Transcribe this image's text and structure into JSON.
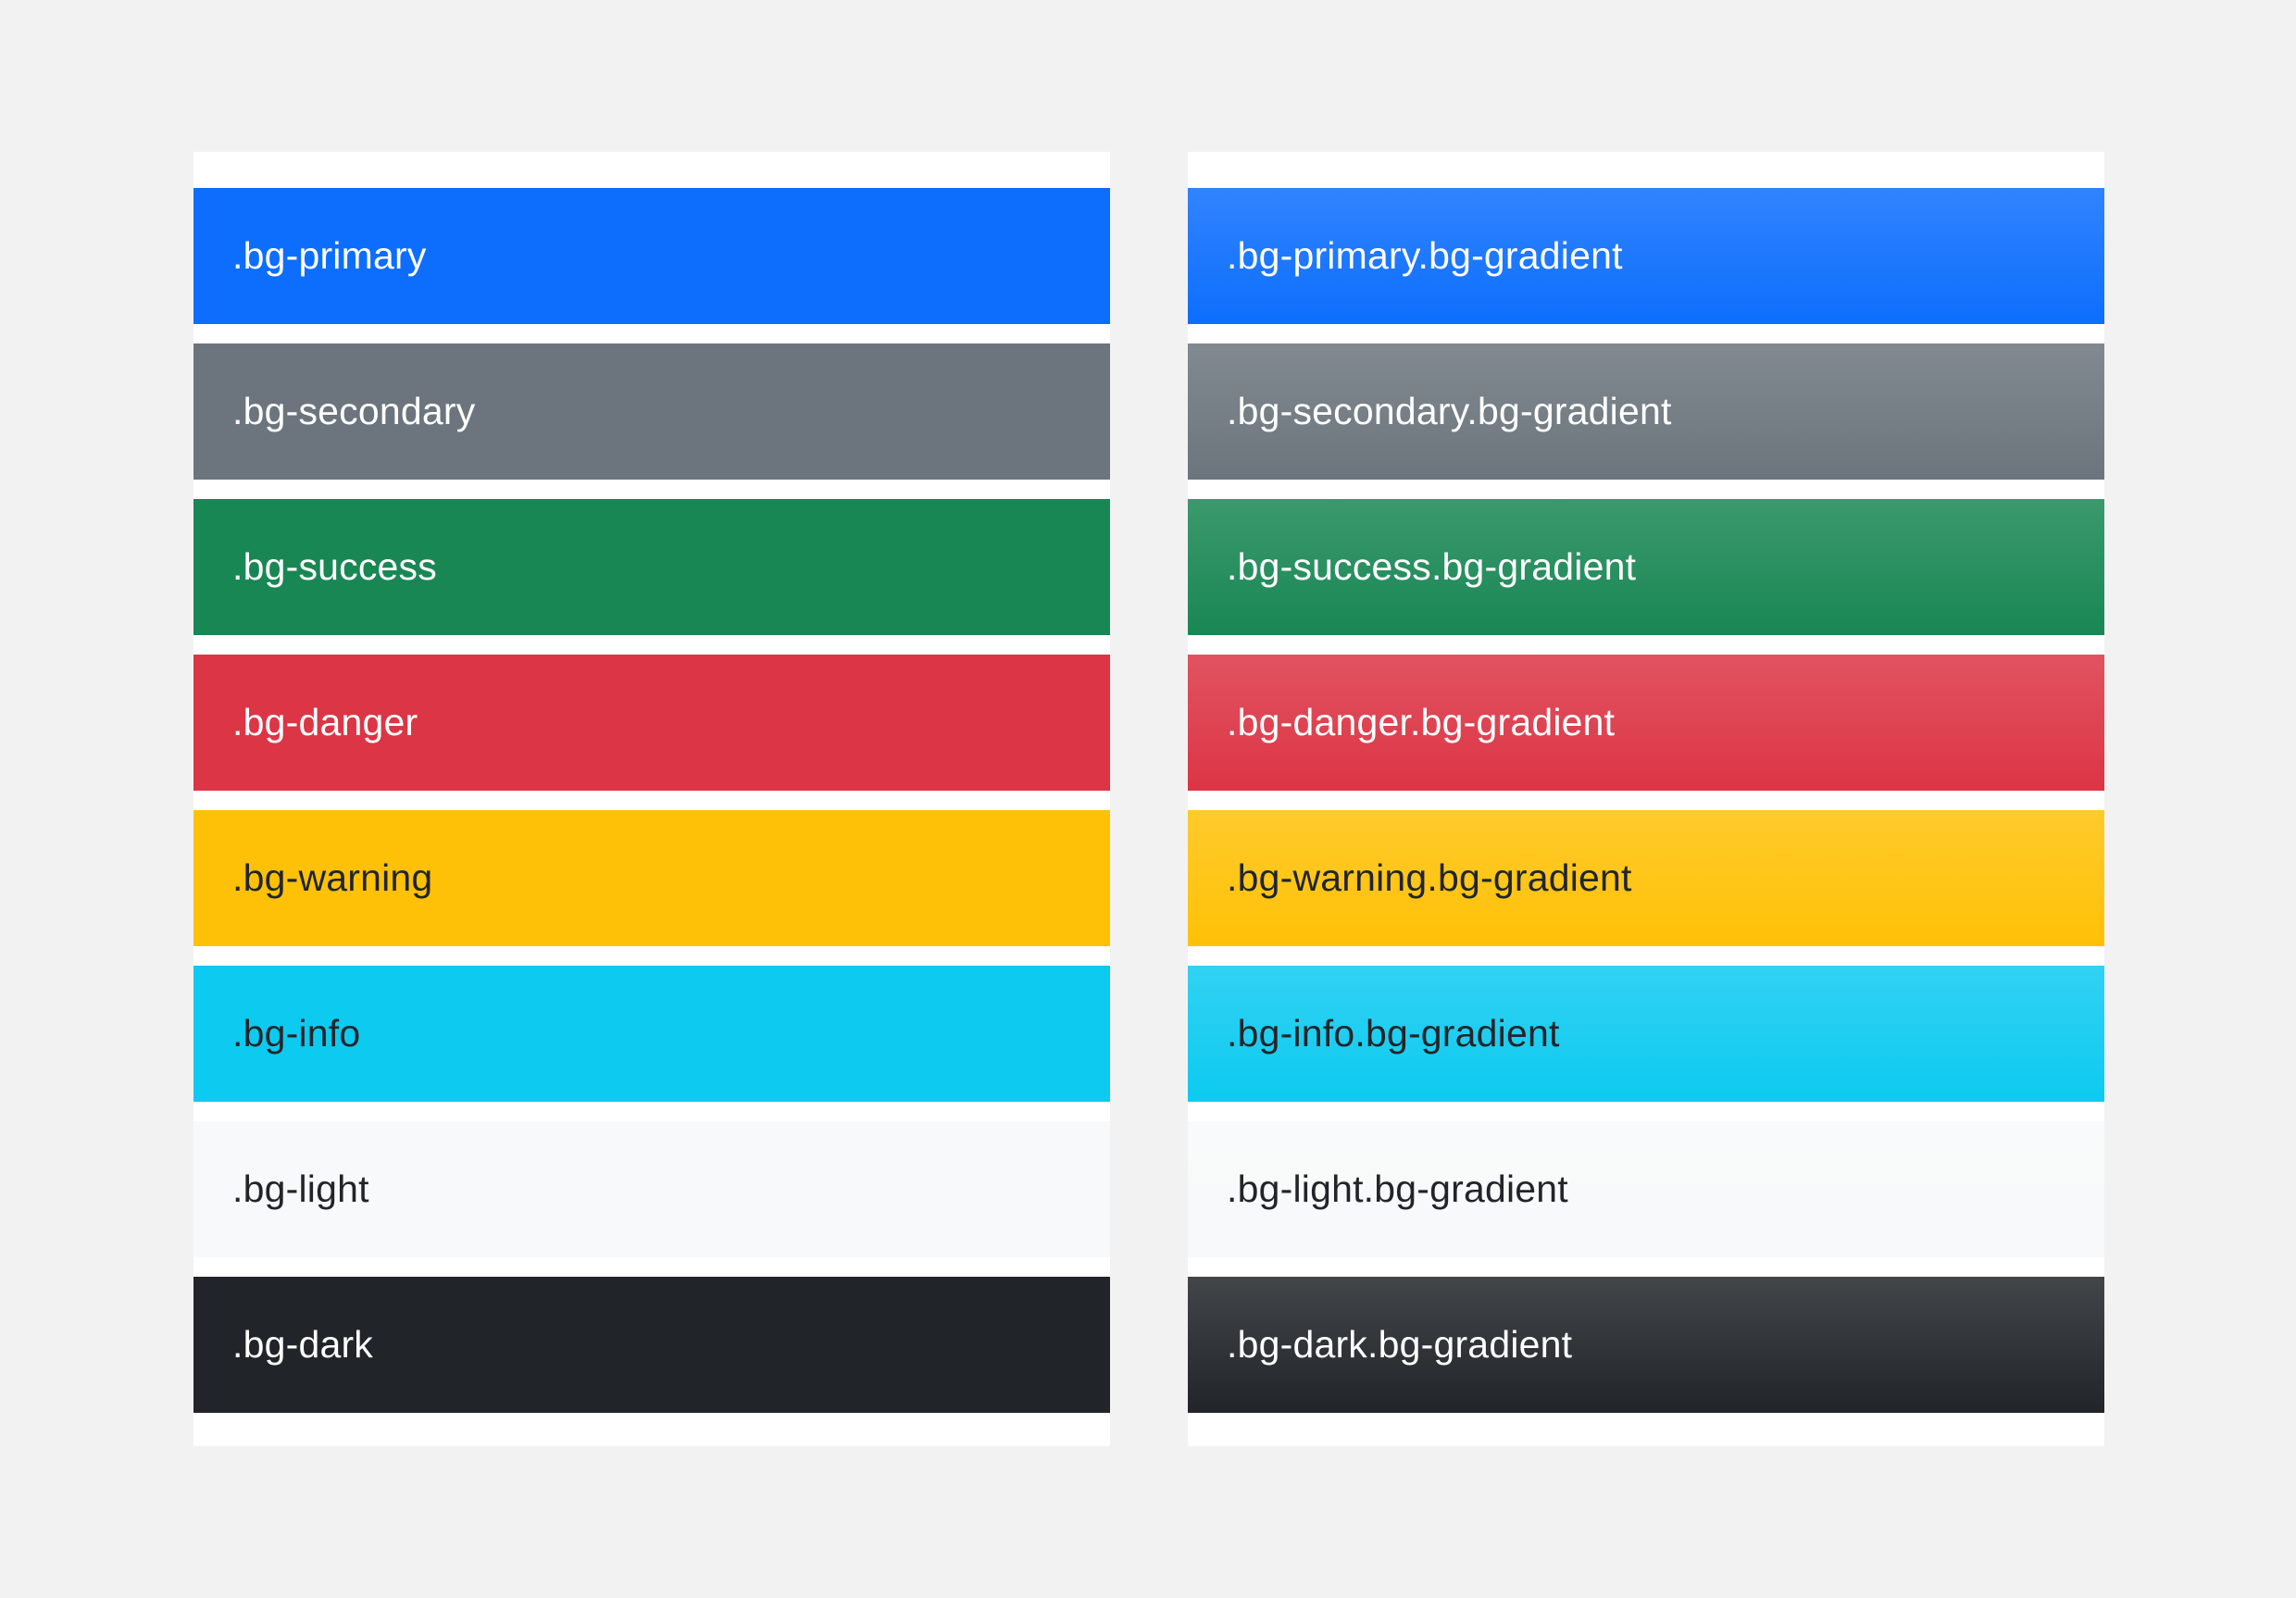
{
  "page": {
    "background": "#f2f2f2",
    "panel_background": "#ffffff"
  },
  "solid": {
    "items": [
      {
        "label": ".bg-primary",
        "bg": "#0d6efd",
        "fg": "#ffffff"
      },
      {
        "label": ".bg-secondary",
        "bg": "#6c757d",
        "fg": "#ffffff"
      },
      {
        "label": ".bg-success",
        "bg": "#198754",
        "fg": "#ffffff"
      },
      {
        "label": ".bg-danger",
        "bg": "#dc3545",
        "fg": "#ffffff"
      },
      {
        "label": ".bg-warning",
        "bg": "#ffc107",
        "fg": "#212529"
      },
      {
        "label": ".bg-info",
        "bg": "#0dcaf0",
        "fg": "#212529"
      },
      {
        "label": ".bg-light",
        "bg": "#f8f9fa",
        "fg": "#212529"
      },
      {
        "label": ".bg-dark",
        "bg": "#212529",
        "fg": "#ffffff"
      }
    ]
  },
  "gradient": {
    "items": [
      {
        "label": ".bg-primary.bg-gradient",
        "bg": "#0d6efd",
        "fg": "#ffffff"
      },
      {
        "label": ".bg-secondary.bg-gradient",
        "bg": "#6c757d",
        "fg": "#ffffff"
      },
      {
        "label": ".bg-success.bg-gradient",
        "bg": "#198754",
        "fg": "#ffffff"
      },
      {
        "label": ".bg-danger.bg-gradient",
        "bg": "#dc3545",
        "fg": "#ffffff"
      },
      {
        "label": ".bg-warning.bg-gradient",
        "bg": "#ffc107",
        "fg": "#212529"
      },
      {
        "label": ".bg-info.bg-gradient",
        "bg": "#0dcaf0",
        "fg": "#212529"
      },
      {
        "label": ".bg-light.bg-gradient",
        "bg": "#f8f9fa",
        "fg": "#212529"
      },
      {
        "label": ".bg-dark.bg-gradient",
        "bg": "#212529",
        "fg": "#ffffff"
      }
    ]
  }
}
